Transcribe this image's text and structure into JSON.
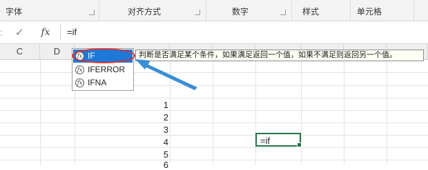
{
  "ribbon": {
    "groups": [
      {
        "label": "字体"
      },
      {
        "label": "对齐方式"
      },
      {
        "label": "数字"
      },
      {
        "label": "样式"
      },
      {
        "label": "单元格"
      }
    ]
  },
  "formula_bar": {
    "cancel_icon": "x-icon",
    "enter_icon": "check-icon",
    "insert_function_label": "fx",
    "formula_text": "=if"
  },
  "columns": [
    "C",
    "D"
  ],
  "row_numbers": [
    "1",
    "2",
    "3",
    "4",
    "5",
    "6"
  ],
  "active_cell": {
    "text": "=if"
  },
  "autocomplete": {
    "items": [
      {
        "name": "IF",
        "icon": "fx",
        "selected": true
      },
      {
        "name": "IFERROR",
        "icon": "fx",
        "selected": false
      },
      {
        "name": "IFNA",
        "icon": "fx",
        "selected": false
      }
    ],
    "tooltip": "判断是否满足某个条件，如果满足返回一个值，如果不满足则返回另一个值。"
  },
  "colors": {
    "highlight": "#1e78d7",
    "annotation_red": "#e0302a",
    "annotation_arrow": "#3b8fd6",
    "active_cell_border": "#217346"
  }
}
